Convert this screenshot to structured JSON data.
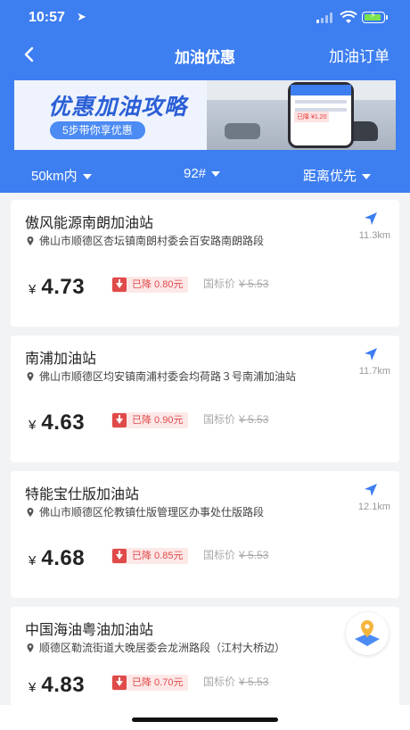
{
  "status_bar": {
    "time": "10:57",
    "location_arrow": "➤"
  },
  "nav": {
    "title": "加油优惠",
    "right_action": "加油订单",
    "back_icon": "chevron-left-icon"
  },
  "banner": {
    "title": "优惠加油攻略",
    "subtitle": "5步带你享优惠",
    "phone_tag": "已降 ¥1.20"
  },
  "filters": {
    "distance": "50km内",
    "fuel": "92#",
    "sort": "距离优先"
  },
  "stations": [
    {
      "name": "傲风能源南朗加油站",
      "address": "佛山市顺德区杏坛镇南朗村委会百安路南朗路段",
      "distance": "11.3km",
      "currency": "¥",
      "price": "4.73",
      "discount": "已降 0.80元",
      "national_label": "国标价",
      "national_price": "¥ 5.53"
    },
    {
      "name": "南浦加油站",
      "address": "佛山市顺德区均安镇南浦村委会均荷路３号南浦加油站",
      "distance": "11.7km",
      "currency": "¥",
      "price": "4.63",
      "discount": "已降 0.90元",
      "national_label": "国标价",
      "national_price": "¥ 5.53"
    },
    {
      "name": "特能宝仕版加油站",
      "address": "佛山市顺德区伦教镇仕版管理区办事处仕版路段",
      "distance": "12.1km",
      "currency": "¥",
      "price": "4.68",
      "discount": "已降 0.85元",
      "national_label": "国标价",
      "national_price": "¥ 5.53"
    },
    {
      "name": "中国海油粤油加油站",
      "address": "顺德区勒流街道大晚居委会龙洲路段（江村大桥边）",
      "distance": "",
      "currency": "¥",
      "price": "4.83",
      "discount": "已降 0.70元",
      "national_label": "国标价",
      "national_price": "¥ 5.53"
    }
  ],
  "colors": {
    "brand": "#3d7ef0",
    "discount": "#e04a4a",
    "background": "#f2f3f5"
  }
}
